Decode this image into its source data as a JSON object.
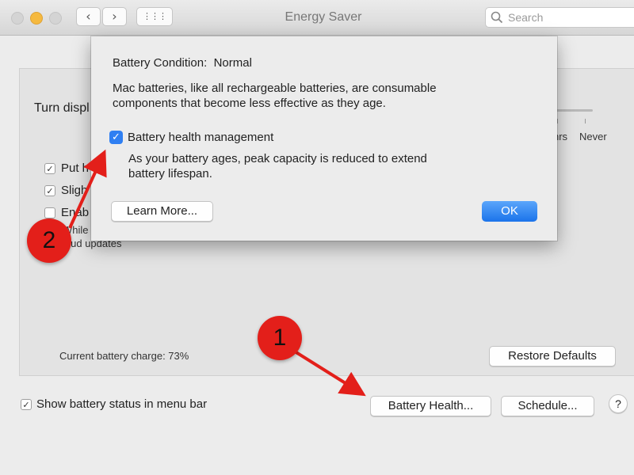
{
  "window": {
    "title": "Energy Saver"
  },
  "search": {
    "placeholder": "Search"
  },
  "toolbar": {
    "back": "‹",
    "forward": "›",
    "grid": "⋮⋮⋮"
  },
  "panel": {
    "turn_display_label": "Turn displ",
    "slider_tick_labels": [
      "hrs",
      "Never"
    ],
    "options": [
      {
        "label": "Put h",
        "checked": true
      },
      {
        "label": "Sligh",
        "checked": true
      },
      {
        "label": "Enab",
        "checked": false
      }
    ],
    "while_text": "While",
    "icloud_text": "loud updates",
    "battery_charge": "Current battery charge: 73%",
    "restore_defaults": "Restore Defaults"
  },
  "footer": {
    "show_status_label": "Show battery status in menu bar",
    "show_status_checked": true,
    "battery_health_button": "Battery Health...",
    "schedule_button": "Schedule...",
    "help_button": "?"
  },
  "dialog": {
    "condition_label": "Battery Condition:",
    "condition_value": "Normal",
    "description_line1": "Mac batteries, like all rechargeable batteries, are consumable",
    "description_line2": "components that become less effective as they age.",
    "checkbox_label": "Battery health management",
    "checkbox_checked": true,
    "help_line1": "As your battery ages, peak capacity is reduced to extend",
    "help_line2": "battery lifespan.",
    "learn_more_button": "Learn More...",
    "ok_button": "OK"
  },
  "annotations": {
    "badge_1": "1",
    "badge_2": "2"
  },
  "colors": {
    "annotation_red": "#e31f1a",
    "checkbox_blue": "#2f7ff2",
    "ok_blue": "#1b73ea"
  }
}
